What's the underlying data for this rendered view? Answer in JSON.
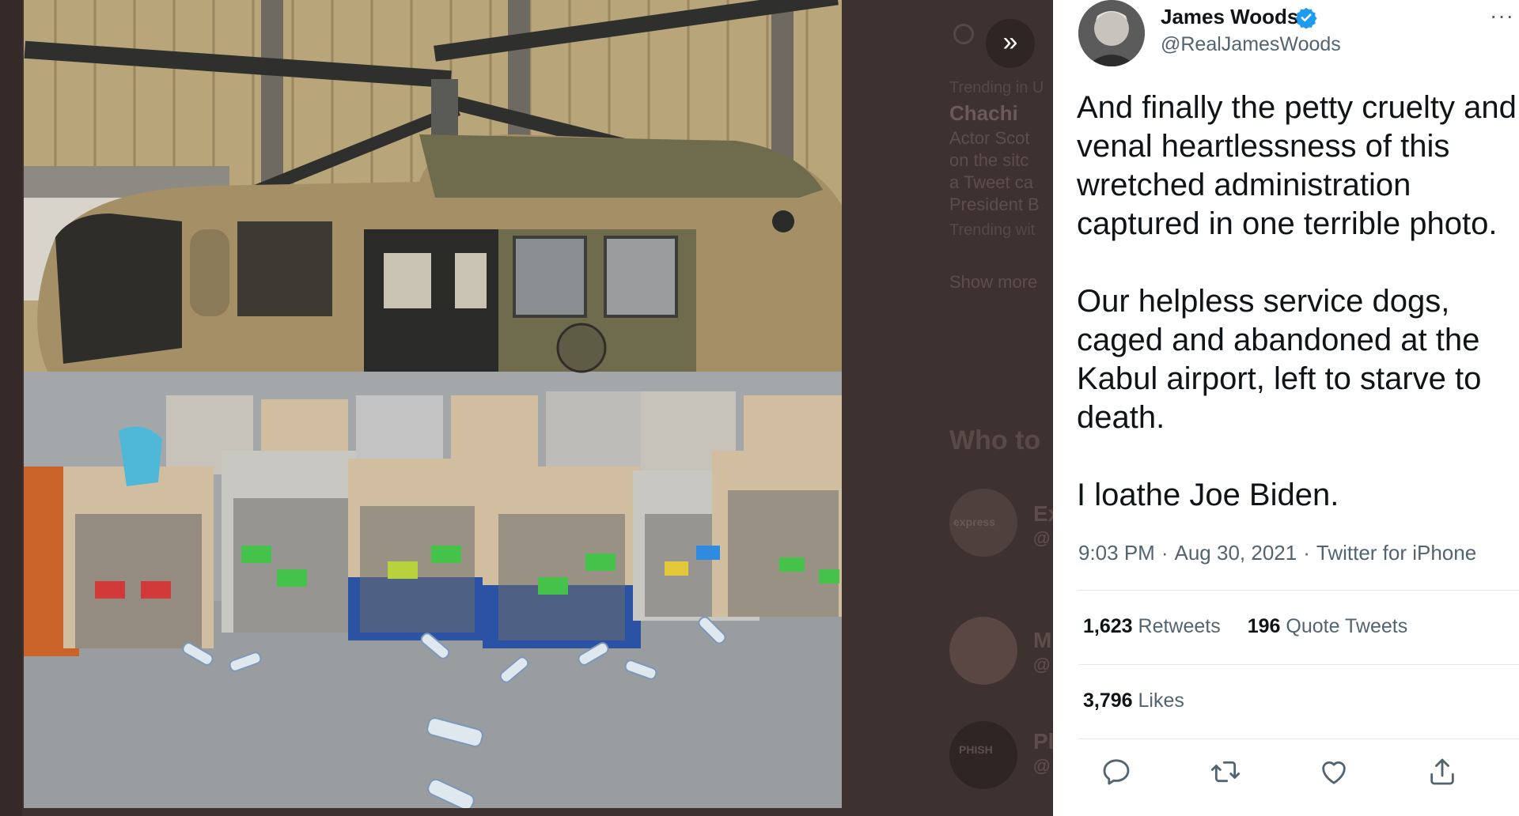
{
  "background_timeline": {
    "trending_label": "Trending in U",
    "trending_title": "Chachi",
    "trending_lines": [
      "Actor Scot",
      "on the sitc",
      "a Tweet ca",
      "President B"
    ],
    "trending_with": "Trending wit",
    "show_more": "Show more",
    "who_to_follow": "Who to",
    "suggestions": [
      {
        "logo_text": "express",
        "initial": "Ex",
        "sub": "@"
      },
      {
        "logo_text": "",
        "initial": "M",
        "sub": "@"
      },
      {
        "logo_text": "PHISH",
        "initial": "Pl",
        "sub": "@"
      }
    ]
  },
  "viewer": {
    "expand_icon": "double-chevron-right-icon",
    "expand_glyph": "»"
  },
  "tweet": {
    "author_name": "James Woods",
    "author_handle": "@RealJamesWoods",
    "verified": true,
    "more_glyph": "···",
    "paragraphs": [
      "And finally the petty cruelty and venal heartlessness of this wretched administration captured in one terrible photo.",
      "Our helpless service dogs, caged and abandoned at the Kabul airport, left to starve to death.",
      "I loathe Joe Biden."
    ],
    "time": "9:03 PM",
    "date": "Aug 30, 2021",
    "source": "Twitter for iPhone",
    "separator": "·",
    "retweets_count": "1,623",
    "retweets_label": "Retweets",
    "quote_count": "196",
    "quote_label": "Quote Tweets",
    "likes_count": "3,796",
    "likes_label": "Likes",
    "actions": [
      "reply-icon",
      "retweet-icon",
      "like-icon",
      "share-icon"
    ]
  },
  "colors": {
    "overlay": "#3e3230",
    "text_primary": "#0f1419",
    "text_secondary": "#536471",
    "verified_blue": "#1d9bf0",
    "divider": "#e1e8ed"
  }
}
